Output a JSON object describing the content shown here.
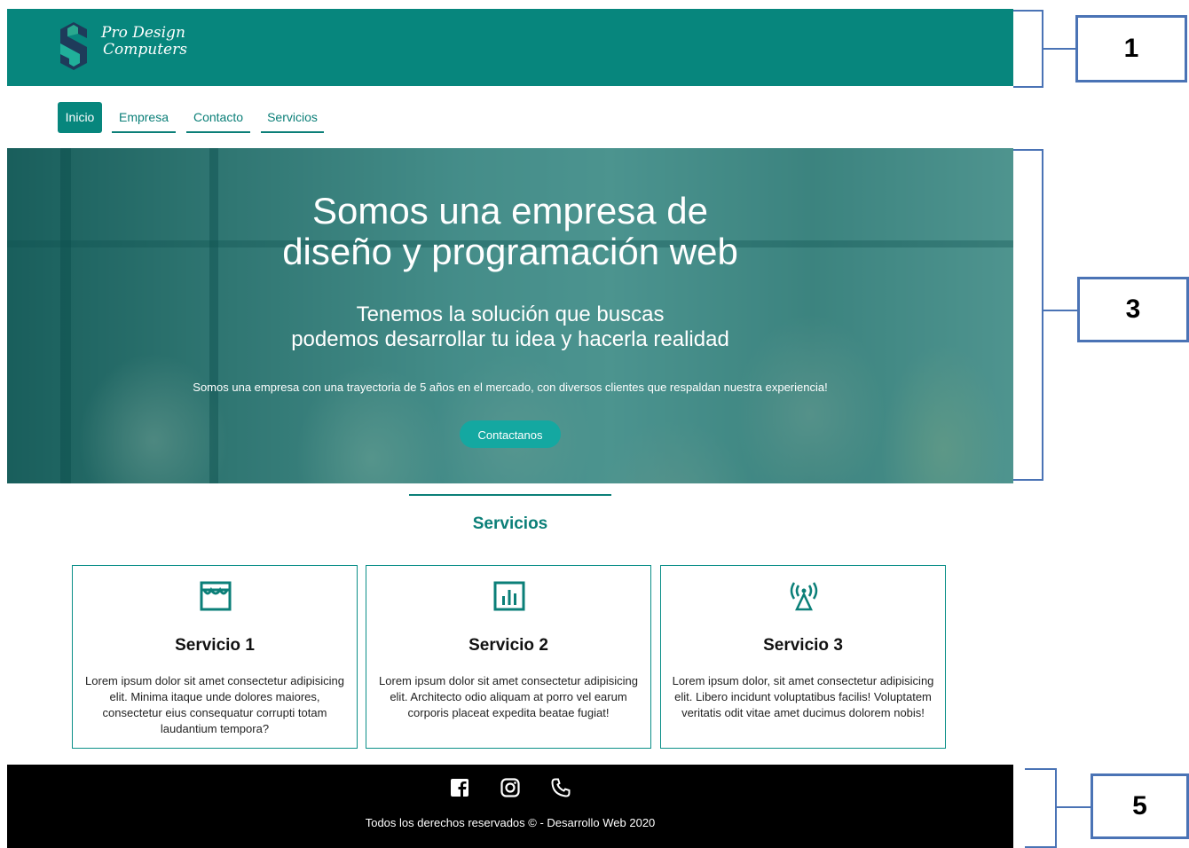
{
  "header": {
    "logo_line1": "Pro Design",
    "logo_line2": "Computers",
    "brand_color": "#07867d"
  },
  "nav": {
    "items": [
      {
        "label": "Inicio",
        "active": true
      },
      {
        "label": "Empresa"
      },
      {
        "label": "Contacto"
      },
      {
        "label": "Servicios"
      }
    ]
  },
  "hero": {
    "title_line1": "Somos una empresa de",
    "title_line2": "diseño y programación web",
    "subtitle_line1": "Tenemos la solución que buscas",
    "subtitle_line2": "podemos desarrollar tu idea y hacerla realidad",
    "text": "Somos una empresa con una trayectoria de 5 años en el mercado, con diversos clientes que respaldan nuestra experiencia!",
    "button_label": "Contactanos"
  },
  "services": {
    "title": "Servicios",
    "cards": [
      {
        "icon": "store-icon",
        "title": "Servicio 1",
        "text": "Lorem ipsum dolor sit amet consectetur adipisicing elit. Minima itaque unde dolores maiores, consectetur eius consequatur corrupti totam laudantium tempora?"
      },
      {
        "icon": "chart-icon",
        "title": "Servicio 2",
        "text": "Lorem ipsum dolor sit amet consectetur adipisicing elit. Architecto odio aliquam at porro vel earum corporis placeat expedita beatae fugiat!"
      },
      {
        "icon": "antenna-icon",
        "title": "Servicio 3",
        "text": "Lorem ipsum dolor, sit amet consectetur adipisicing elit. Libero incidunt voluptatibus facilis! Voluptatem veritatis odit vitae amet ducimus dolorem nobis!"
      }
    ]
  },
  "footer": {
    "icons": [
      "facebook-icon",
      "instagram-icon",
      "phone-icon"
    ],
    "copyright": "Todos los derechos reservados © - Desarrollo Web 2020"
  },
  "annotations": {
    "labels": [
      "1",
      "3",
      "5"
    ],
    "color": "#4a73b5"
  }
}
